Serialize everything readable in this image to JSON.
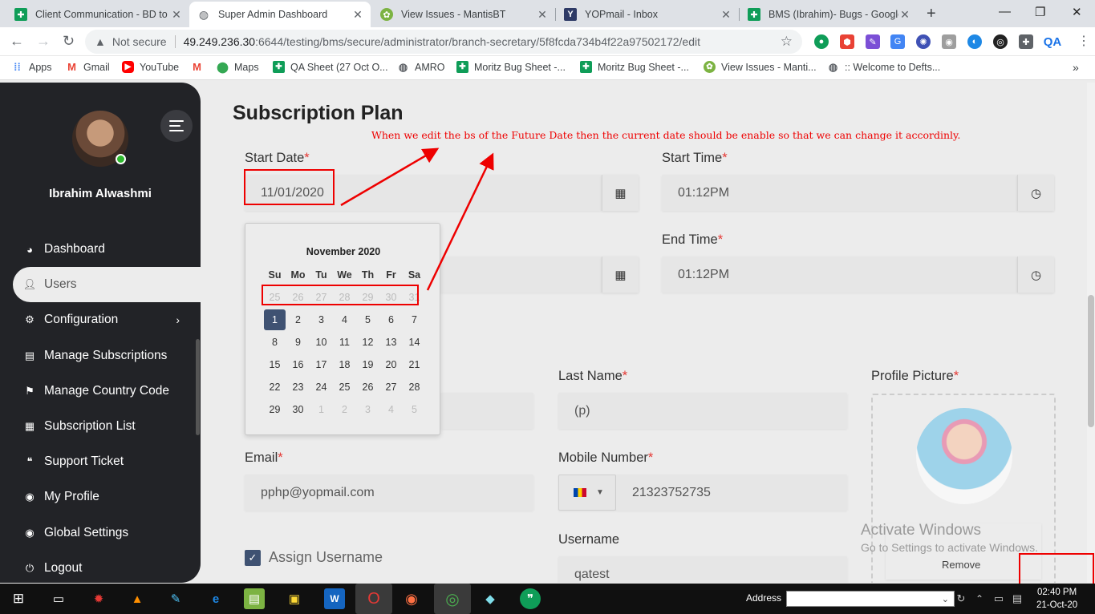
{
  "browser": {
    "tabs": [
      {
        "title": "Client Communication - BD to",
        "icon": "sheets-icon"
      },
      {
        "title": "Super Admin Dashboard",
        "icon": "globe-icon",
        "active": true
      },
      {
        "title": "View Issues - MantisBT",
        "icon": "mantis-icon"
      },
      {
        "title": "YOPmail - Inbox",
        "icon": "yopmail-icon"
      },
      {
        "title": "BMS (Ibrahim)- Bugs - Google",
        "icon": "sheets-icon"
      }
    ],
    "address": {
      "security_label": "Not secure",
      "host": "49.249.236.30",
      "path": ":6644/testing/bms/secure/administrator/branch-secretary/5f8fcda734b4f22a97502172/edit"
    },
    "profile_label": "QA",
    "bookmarks": [
      "Apps",
      "Gmail",
      "YouTube",
      "",
      "Maps",
      "QA Sheet (27 Oct O...",
      "AMRO",
      "Moritz Bug Sheet -...",
      "Moritz Bug Sheet -...",
      "View Issues - Manti...",
      ":: Welcome to Defts..."
    ]
  },
  "sidebar": {
    "user_name": "Ibrahim Alwashmi",
    "items": [
      {
        "label": "Dashboard",
        "icon": "dashboard-icon"
      },
      {
        "label": "Users",
        "icon": "user-icon",
        "active": true
      },
      {
        "label": "Configuration",
        "icon": "gears-icon",
        "has_submenu": true
      },
      {
        "label": "Manage Subscriptions",
        "icon": "money-icon"
      },
      {
        "label": "Manage Country Code",
        "icon": "flag-icon"
      },
      {
        "label": "Subscription List",
        "icon": "clipboard-icon"
      },
      {
        "label": "Support Ticket",
        "icon": "comments-icon"
      },
      {
        "label": "My Profile",
        "icon": "user-circle-icon"
      },
      {
        "label": "Global Settings",
        "icon": "user-circle-icon"
      },
      {
        "label": "Logout",
        "icon": "power-icon"
      }
    ]
  },
  "form": {
    "section_title": "Subscription Plan",
    "start_date": {
      "label": "Start Date",
      "value": "11/01/2020"
    },
    "start_time": {
      "label": "Start Time",
      "value": "01:12PM"
    },
    "end_time": {
      "label": "End Time",
      "value": "01:12PM"
    },
    "last_name": {
      "label": "Last Name",
      "value": "(p)"
    },
    "profile_picture": {
      "label": "Profile Picture",
      "remove_label": "Remove"
    },
    "email": {
      "label": "Email",
      "value": "pphp@yopmail.com"
    },
    "mobile": {
      "label": "Mobile Number",
      "value": "21323752735"
    },
    "username": {
      "label": "Username",
      "value": "qatest"
    },
    "assign_username": {
      "label": "Assign Username",
      "checked": true
    },
    "required_mark": "*"
  },
  "datepicker": {
    "month_title": "November 2020",
    "weekdays": [
      "Su",
      "Mo",
      "Tu",
      "We",
      "Th",
      "Fr",
      "Sa"
    ],
    "weeks": [
      [
        {
          "d": "25",
          "dim": true
        },
        {
          "d": "26",
          "dim": true
        },
        {
          "d": "27",
          "dim": true
        },
        {
          "d": "28",
          "dim": true
        },
        {
          "d": "29",
          "dim": true
        },
        {
          "d": "30",
          "dim": true
        },
        {
          "d": "31",
          "dim": true
        }
      ],
      [
        {
          "d": "1",
          "sel": true
        },
        {
          "d": "2"
        },
        {
          "d": "3"
        },
        {
          "d": "4"
        },
        {
          "d": "5"
        },
        {
          "d": "6"
        },
        {
          "d": "7"
        }
      ],
      [
        {
          "d": "8"
        },
        {
          "d": "9"
        },
        {
          "d": "10"
        },
        {
          "d": "11"
        },
        {
          "d": "12"
        },
        {
          "d": "13"
        },
        {
          "d": "14"
        }
      ],
      [
        {
          "d": "15"
        },
        {
          "d": "16"
        },
        {
          "d": "17"
        },
        {
          "d": "18"
        },
        {
          "d": "19"
        },
        {
          "d": "20"
        },
        {
          "d": "21"
        }
      ],
      [
        {
          "d": "22"
        },
        {
          "d": "23"
        },
        {
          "d": "24"
        },
        {
          "d": "25"
        },
        {
          "d": "26"
        },
        {
          "d": "27"
        },
        {
          "d": "28"
        }
      ],
      [
        {
          "d": "29"
        },
        {
          "d": "30"
        },
        {
          "d": "1",
          "dim": true
        },
        {
          "d": "2",
          "dim": true
        },
        {
          "d": "3",
          "dim": true
        },
        {
          "d": "4",
          "dim": true
        },
        {
          "d": "5",
          "dim": true
        }
      ]
    ]
  },
  "annotation": {
    "text": "When we edit the bs of the Future Date then the current date should be enable so that we can change it accordinly.",
    "color": "#ee0000"
  },
  "watermark": {
    "line1": "Activate Windows",
    "line2": "Go to Settings to activate Windows."
  },
  "taskbar": {
    "address_label": "Address",
    "time": "02:40 PM",
    "date": "21-Oct-20"
  },
  "colors": {
    "sidebar_bg": "#222327",
    "accent": "#3f5272",
    "required": "#e53935"
  }
}
